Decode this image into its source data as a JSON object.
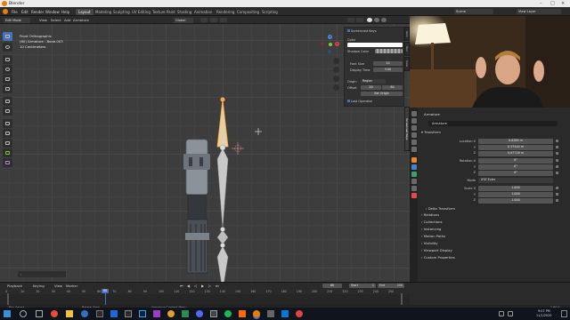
{
  "window": {
    "title": "Blender"
  },
  "menu": {
    "items": [
      "File",
      "Edit",
      "Render",
      "Window",
      "Help"
    ],
    "workspaces": [
      "Layout",
      "Modeling",
      "Sculpting",
      "UV Editing",
      "Texture Paint",
      "Shading",
      "Animation",
      "Rendering",
      "Compositing",
      "Scripting"
    ],
    "active_workspace": "Layout",
    "scene_label": "Scene",
    "view_layer_label": "View Layer"
  },
  "viewport_header": {
    "mode": "Edit Mode",
    "menus": [
      "View",
      "Select",
      "Add",
      "Armature"
    ],
    "transform_orientation": "Global"
  },
  "viewport": {
    "view_name": "Front Orthographic",
    "object_info": "(60) Armature : Bone.003",
    "scale_info": "10 Centimeters"
  },
  "n_panel": {
    "title": "Screencast Keys",
    "color_label": "Color",
    "shadow_color_label": "Shadow Color",
    "font_size_label": "Font Size",
    "font_size_value": "12",
    "display_time_label": "Display Time",
    "display_time_value": "3.00",
    "origin_label": "Origin",
    "origin_value": "Region",
    "offset_label": "Offset",
    "offset_x": "20",
    "offset_y": "80",
    "set_origin_label": "Set Origin",
    "last_operator_label": "Last Operator",
    "side_tabs": [
      "Item",
      "Tool",
      "View",
      "Screencast Keys"
    ]
  },
  "properties": {
    "breadcrumb": "Armature",
    "object_name": "Armature",
    "transform_label": "Transform",
    "location_label": "Location X",
    "location": [
      "0.6284 m",
      "0.37444 m",
      "0.67728 m"
    ],
    "rotation_label": "Rotation X",
    "rotation": [
      "0°",
      "0°",
      "0°"
    ],
    "mode_label": "Mode",
    "mode_value": "XYZ Euler",
    "scale_label": "Scale X",
    "scale": [
      "1.000",
      "1.000",
      "1.000"
    ],
    "axis_y": "Y",
    "axis_z": "Z",
    "delta_transform_label": "Delta Transform",
    "sections": [
      "Relations",
      "Collections",
      "Instancing",
      "Motion Paths",
      "Visibility",
      "Viewport Display",
      "Custom Properties"
    ]
  },
  "timeline": {
    "menus": [
      "Playback",
      "Keying",
      "View",
      "Marker"
    ],
    "current_frame": "60",
    "start_label": "Start",
    "start_value": "1",
    "end_label": "End",
    "end_value": "250",
    "ticks": [
      "0",
      "10",
      "20",
      "30",
      "40",
      "50",
      "60",
      "70",
      "80",
      "90",
      "100",
      "110",
      "120",
      "130",
      "140",
      "150",
      "160",
      "170",
      "180",
      "190",
      "200",
      "210",
      "220",
      "230",
      "240",
      "250"
    ]
  },
  "statusbar": {
    "select_label": "Box Select",
    "rotate_label": "Rotate View",
    "context_label": "Armature Context Menu",
    "version": "2.90.0"
  },
  "taskbar": {
    "time": "9:07 PM",
    "date": "11/1/2020"
  },
  "colors": {
    "accent": "#4772b3",
    "active_bone": "#ffaa40",
    "blender_orange": "#e87d0d"
  }
}
